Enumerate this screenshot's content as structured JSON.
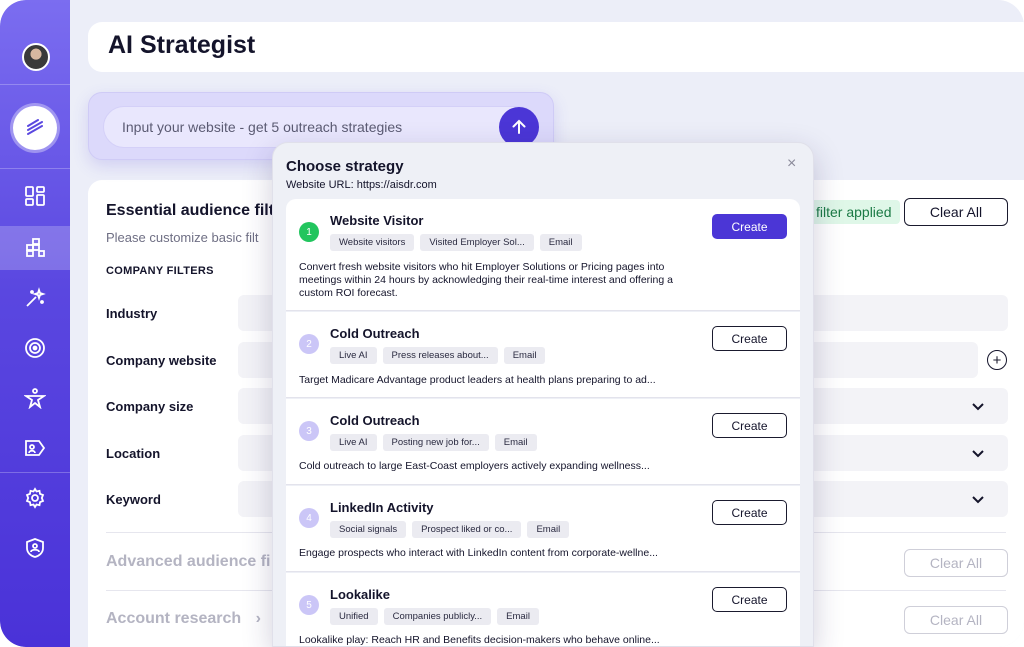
{
  "app": {
    "title": "AI Strategist"
  },
  "search": {
    "placeholder": "Input your website - get 5 outreach strategies"
  },
  "filters": {
    "essential_title": "Essential audience filt",
    "essential_subtitle": "Please customize basic filt",
    "company_filters_caption": "COMPANY FILTERS",
    "filter_applied": "filter applied",
    "clear_all": "Clear All",
    "rows": [
      {
        "label": "Industry"
      },
      {
        "label": "Company website"
      },
      {
        "label": "Company size"
      },
      {
        "label": "Location"
      },
      {
        "label": "Keyword"
      }
    ],
    "advanced_title": "Advanced audience fi",
    "account_title": "Account research"
  },
  "modal": {
    "title": "Choose strategy",
    "url": "Website URL: https://aisdr.com",
    "close": "×",
    "cards": [
      {
        "number": "1",
        "title": "Website Visitor",
        "tags": [
          "Website visitors",
          "Visited Employer Sol...",
          "Email"
        ],
        "description": "Convert fresh website visitors who hit Employer Solutions or Pricing pages into meetings within 24 hours by acknowledging their real-time interest and offering a custom ROI forecast.",
        "button": "Create"
      },
      {
        "number": "2",
        "title": "Cold Outreach",
        "tags": [
          "Live AI",
          "Press releases about...",
          "Email"
        ],
        "description": "Target Madicare Advantage product leaders at health plans preparing to ad...",
        "button": "Create"
      },
      {
        "number": "3",
        "title": "Cold Outreach",
        "tags": [
          "Live AI",
          "Posting new job for...",
          "Email"
        ],
        "description": "Cold outreach to large East-Coast employers actively expanding wellness...",
        "button": "Create"
      },
      {
        "number": "4",
        "title": "LinkedIn Activity",
        "tags": [
          "Social signals",
          "Prospect liked or co...",
          "Email"
        ],
        "description": "Engage prospects who interact with LinkedIn content from corporate-wellne...",
        "button": "Create"
      },
      {
        "number": "5",
        "title": "Lookalike",
        "tags": [
          "Unified",
          "Companies publicly...",
          "Email"
        ],
        "description": "Lookalike play: Reach HR and Benefits decision-makers who behave online...",
        "button": "Create"
      }
    ]
  },
  "icons": {
    "accent": "#4b36d6",
    "success": "#22c55e"
  }
}
